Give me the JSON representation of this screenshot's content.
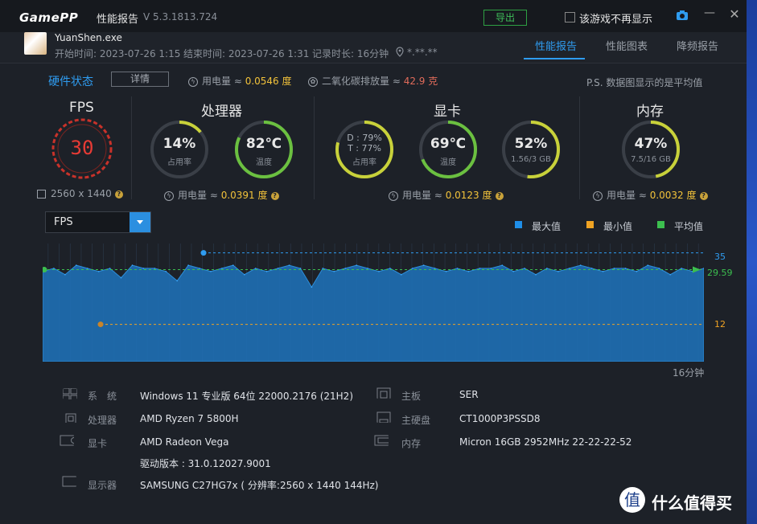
{
  "window": {
    "logo": "GamePP",
    "title": "性能报告",
    "version": "V 5.3.1813.724",
    "export_label": "导出",
    "hide_game_label": "该游戏不再显示",
    "minimize_label": "—",
    "close_label": "✕"
  },
  "session": {
    "exe": "YuanShen.exe",
    "start": "开始时间: 2023-07-26 1:15",
    "end": "结束时间: 2023-07-26 1:31",
    "duration": "记录时长: 16分钟",
    "location": "*.**.**"
  },
  "tabs": [
    {
      "label": "性能报告",
      "active": true
    },
    {
      "label": "性能图表",
      "active": false
    },
    {
      "label": "降频报告",
      "active": false
    }
  ],
  "hardware_state": {
    "title": "硬件状态",
    "detail_label": "详情",
    "power_label": "用电量 ≈",
    "power_value": "0.0546 度",
    "co2_label": "二氧化碳排放量 ≈",
    "co2_value": "42.9 克",
    "note": "P.S. 数据图显示的是平均值"
  },
  "fps": {
    "title": "FPS",
    "value": "30",
    "resolution": "2560 x 1440"
  },
  "cpu": {
    "title": "处理器",
    "usage_value": "14%",
    "usage_label": "占用率",
    "usage_frac": 0.14,
    "temp_value": "82℃",
    "temp_label": "温度",
    "temp_frac": 0.82,
    "power_label": "用电量 ≈",
    "power_value": "0.0391 度"
  },
  "gpu": {
    "title": "显卡",
    "d_value": "D : 79%",
    "t_value": "T : 77%",
    "usage_label": "占用率",
    "usage_frac": 0.79,
    "temp_value": "69℃",
    "temp_label": "温度",
    "temp_frac": 0.69,
    "mem_value": "52%",
    "mem_sub": "1.56/3 GB",
    "mem_frac": 0.52,
    "power_label": "用电量 ≈",
    "power_value": "0.0123 度"
  },
  "memory": {
    "title": "内存",
    "value": "47%",
    "sub": "7.5/16 GB",
    "frac": 0.47,
    "power_label": "用电量 ≈",
    "power_value": "0.0032 度"
  },
  "chart_controls": {
    "selected": "FPS",
    "legend": [
      {
        "label": "最大值",
        "color": "#1f8ee8"
      },
      {
        "label": "最小值",
        "color": "#f0a323"
      },
      {
        "label": "平均值",
        "color": "#3cbf4f"
      }
    ]
  },
  "chart_data": {
    "type": "area",
    "x_label_end": "16分钟",
    "max": "35",
    "avg": "29.59",
    "min": "12",
    "ylim": [
      0,
      38
    ],
    "series": [
      {
        "name": "FPS",
        "values": [
          29,
          30,
          28,
          31,
          30,
          29,
          30,
          27,
          31,
          30,
          30,
          29,
          26,
          31,
          30,
          29,
          30,
          31,
          28,
          30,
          29,
          30,
          31,
          30,
          24,
          30,
          29,
          30,
          31,
          30,
          29,
          30,
          28,
          30,
          31,
          30,
          29,
          30,
          29,
          30,
          30,
          31,
          29,
          30,
          28,
          30,
          29,
          30,
          31,
          30,
          29,
          30,
          30,
          29,
          31,
          30,
          28,
          30,
          29,
          30
        ]
      }
    ]
  },
  "system_info": [
    {
      "icon": "windows-icon",
      "label": "系　统",
      "value": "Windows 11 专业版 64位 22000.2176 (21H2)"
    },
    {
      "icon": "cpu-icon",
      "label": "处理器",
      "value": "AMD Ryzen 7 5800H"
    },
    {
      "icon": "gpu-icon",
      "label": "显卡",
      "value": "AMD Radeon Vega",
      "extra": "驱动版本 : 31.0.12027.9001"
    },
    {
      "icon": "monitor-icon",
      "label": "显示器",
      "value": "SAMSUNG C27HG7x ( 分辨率:2560 x 1440 144Hz)"
    }
  ],
  "system_info_right": [
    {
      "icon": "motherboard-icon",
      "label": "主板",
      "value": "SER"
    },
    {
      "icon": "disk-icon",
      "label": "主硬盘",
      "value": "CT1000P3PSSD8"
    },
    {
      "icon": "memory-icon",
      "label": "内存",
      "value": "Micron 16GB 2952MHz 22-22-22-52"
    }
  ],
  "watermark": "什么值得买"
}
